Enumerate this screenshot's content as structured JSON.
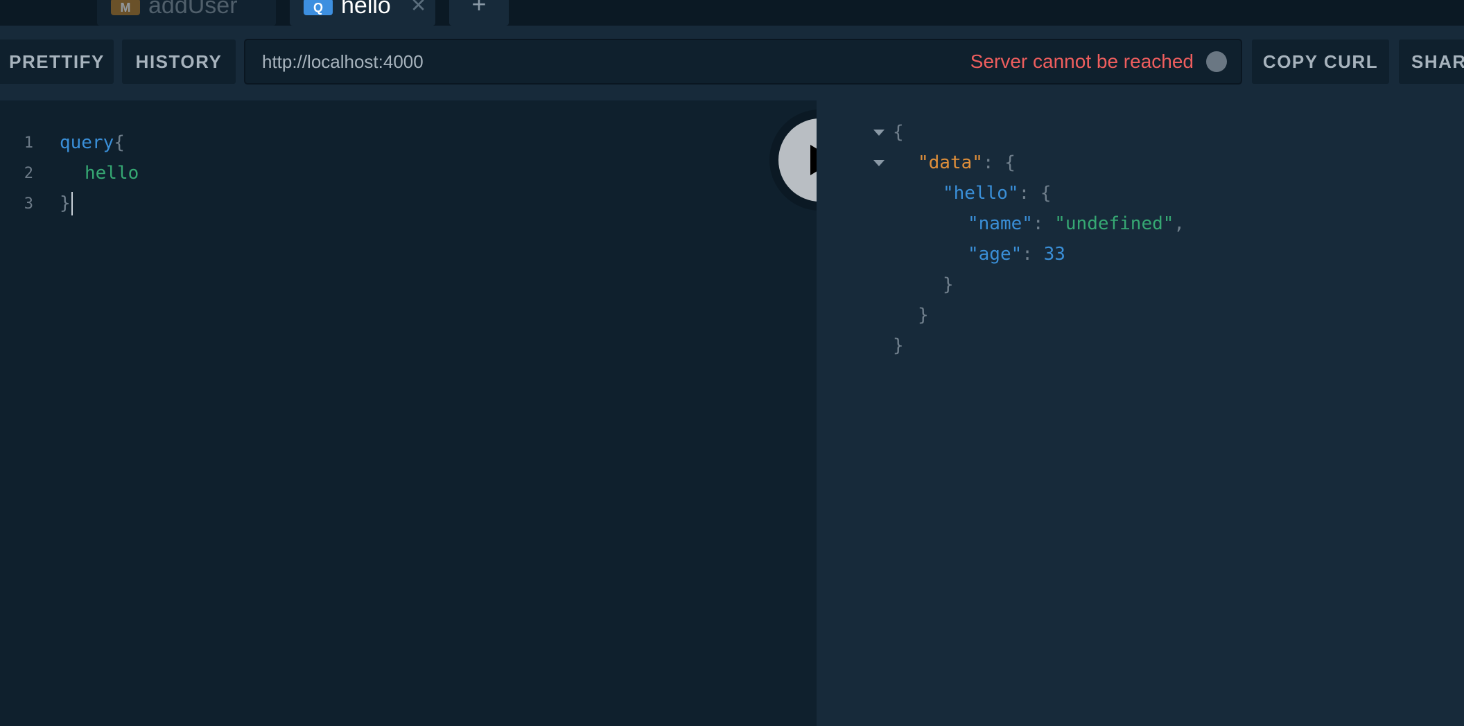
{
  "tabs": [
    {
      "badge": "M",
      "label": "addUser",
      "active": false
    },
    {
      "badge": "Q",
      "label": "hello",
      "active": true,
      "close": "✕"
    }
  ],
  "new_tab_label": "+",
  "toolbar": {
    "prettify_label": "PRETTIFY",
    "history_label": "HISTORY",
    "copy_curl_label": "COPY CURL",
    "share_label": "SHARE"
  },
  "endpoint": {
    "url": "http://localhost:4000",
    "status": "Server cannot be reached",
    "status_color": "#ef5e5e"
  },
  "editor": {
    "lines": [
      {
        "num": "1",
        "keyword": "query",
        "punct": "{"
      },
      {
        "num": "2",
        "field": "hello"
      },
      {
        "num": "3",
        "punct": "}"
      }
    ]
  },
  "execute_icon": "play-icon",
  "result": {
    "open_brace": "{",
    "data_key": "\"data\"",
    "hello_key": "\"hello\"",
    "name_key": "\"name\"",
    "name_value": "\"undefined\"",
    "age_key": "\"age\"",
    "age_value": "33",
    "colon": ": ",
    "comma": ",",
    "close_brace": "}"
  },
  "colors": {
    "background": "#172a3a",
    "editor_background": "#0f202d",
    "keyword": "#3a8fd8",
    "field": "#36a873",
    "data_key": "#e08f3a"
  }
}
